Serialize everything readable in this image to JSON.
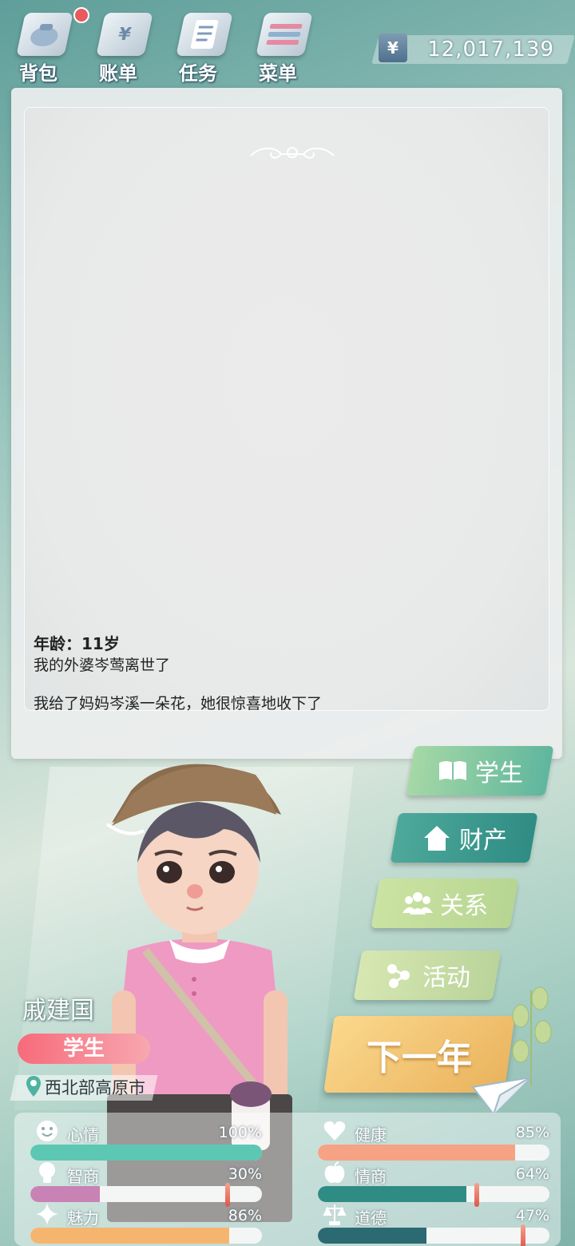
{
  "nav": {
    "bag": "背包",
    "bill": "账单",
    "task": "任务",
    "menu": "菜单"
  },
  "money": {
    "symbol": "¥",
    "value": "12,017,139"
  },
  "log": {
    "age": "年龄：11岁",
    "line1": "我的外婆岑莺离世了",
    "line2": "我给了妈妈岑溪一朵花，她很惊喜地收下了"
  },
  "character": {
    "name": "戚建国",
    "job": "学生",
    "location": "西北部高原市"
  },
  "actions": {
    "study": "学生",
    "property": "财产",
    "relations": "关系",
    "activity": "活动",
    "next_year": "下一年"
  },
  "stats": {
    "mood": {
      "label": "心情",
      "value": "100%",
      "level": 1.0,
      "color": "#5cc7b3"
    },
    "health": {
      "label": "健康",
      "value": "85%",
      "level": 0.85,
      "color": "#f6a284"
    },
    "iq": {
      "label": "智商",
      "value": "30%",
      "level": 0.3,
      "color": "#c982b4"
    },
    "eq": {
      "label": "情商",
      "value": "64%",
      "level": 0.64,
      "color": "#2f8c84"
    },
    "charm": {
      "label": "魅力",
      "value": "86%",
      "level": 0.86,
      "color": "#f6b56f"
    },
    "morality": {
      "label": "道德",
      "value": "47%",
      "level": 0.47,
      "color": "#2b6a72"
    }
  }
}
